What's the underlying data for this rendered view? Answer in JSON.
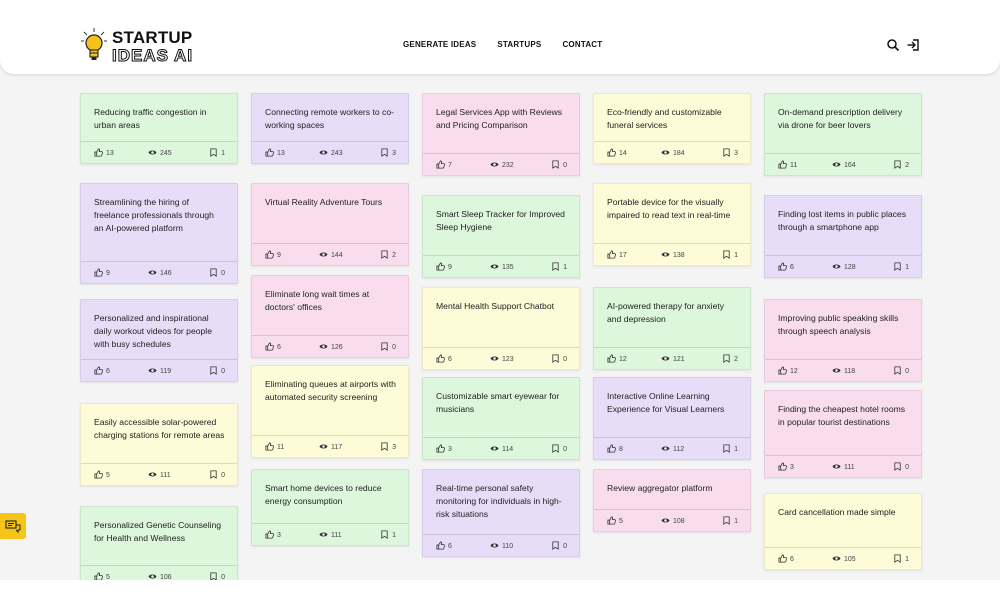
{
  "brand": {
    "name_top": "STARTUP",
    "name_bottom": "IDEAS AI"
  },
  "nav": {
    "items": [
      "GENERATE IDEAS",
      "STARTUPS",
      "CONTACT"
    ]
  },
  "columns": [
    [
      {
        "title": "Reducing traffic congestion in urban areas",
        "likes": "13",
        "views": "245",
        "saves": "1",
        "color": "green"
      },
      {
        "title": "Streamlining the hiring of freelance professionals through an AI-powered platform",
        "likes": "9",
        "views": "146",
        "saves": "0",
        "color": "purple"
      },
      {
        "title": "Personalized and inspirational daily workout videos for people with busy schedules",
        "likes": "6",
        "views": "119",
        "saves": "0",
        "color": "purple"
      },
      {
        "title": "Easily accessible solar-powered charging stations for remote areas",
        "likes": "5",
        "views": "111",
        "saves": "0",
        "color": "yellow"
      },
      {
        "title": "Personalized Genetic Counseling for Health and Wellness",
        "likes": "5",
        "views": "106",
        "saves": "0",
        "color": "green"
      }
    ],
    [
      {
        "title": "Connecting remote workers to co-working spaces",
        "likes": "13",
        "views": "243",
        "saves": "3",
        "color": "purple"
      },
      {
        "title": "Virtual Reality Adventure Tours",
        "likes": "9",
        "views": "144",
        "saves": "2",
        "color": "pink"
      },
      {
        "title": "Eliminate long wait times at doctors' offices",
        "likes": "6",
        "views": "126",
        "saves": "0",
        "color": "pink"
      },
      {
        "title": "Eliminating queues at airports with automated security screening",
        "likes": "11",
        "views": "117",
        "saves": "3",
        "color": "yellow"
      },
      {
        "title": "Smart home devices to reduce energy consumption",
        "likes": "3",
        "views": "111",
        "saves": "1",
        "color": "green"
      }
    ],
    [
      {
        "title": "Legal Services App with Reviews and Pricing Comparison",
        "likes": "7",
        "views": "232",
        "saves": "0",
        "color": "pink"
      },
      {
        "title": "Smart Sleep Tracker for Improved Sleep Hygiene",
        "likes": "9",
        "views": "135",
        "saves": "1",
        "color": "green"
      },
      {
        "title": "Mental Health Support Chatbot",
        "likes": "6",
        "views": "123",
        "saves": "0",
        "color": "yellow"
      },
      {
        "title": "Customizable smart eyewear for musicians",
        "likes": "3",
        "views": "114",
        "saves": "0",
        "color": "green"
      },
      {
        "title": "Real-time personal safety monitoring for individuals in high-risk situations",
        "likes": "6",
        "views": "110",
        "saves": "0",
        "color": "purple"
      }
    ],
    [
      {
        "title": "Eco-friendly and customizable funeral services",
        "likes": "14",
        "views": "184",
        "saves": "3",
        "color": "yellow"
      },
      {
        "title": "Portable device for the visually impaired to read text in real-time",
        "likes": "17",
        "views": "138",
        "saves": "1",
        "color": "yellow"
      },
      {
        "title": "AI-powered therapy for anxiety and depression",
        "likes": "12",
        "views": "121",
        "saves": "2",
        "color": "green"
      },
      {
        "title": "Interactive Online Learning Experience for Visual Learners",
        "likes": "8",
        "views": "112",
        "saves": "1",
        "color": "purple"
      },
      {
        "title": "Review aggregator platform",
        "likes": "5",
        "views": "108",
        "saves": "1",
        "color": "pink"
      }
    ],
    [
      {
        "title": "On-demand prescription delivery via drone for beer lovers",
        "likes": "11",
        "views": "164",
        "saves": "2",
        "color": "green"
      },
      {
        "title": "Finding lost items in public places through a smartphone app",
        "likes": "6",
        "views": "128",
        "saves": "1",
        "color": "purple"
      },
      {
        "title": "Improving public speaking skills through speech analysis",
        "likes": "12",
        "views": "118",
        "saves": "0",
        "color": "pink"
      },
      {
        "title": "Finding the cheapest hotel rooms in popular tourist destinations",
        "likes": "3",
        "views": "111",
        "saves": "0",
        "color": "pink"
      },
      {
        "title": "Card cancellation made simple",
        "likes": "6",
        "views": "105",
        "saves": "1",
        "color": "yellow"
      }
    ]
  ],
  "icons": {
    "logo": "lightbulb-icon",
    "search": "search-icon",
    "login": "login-icon",
    "like": "thumbs-up-icon",
    "views": "eye-icon",
    "saves": "bookmark-icon",
    "feedback": "feedback-icon"
  }
}
